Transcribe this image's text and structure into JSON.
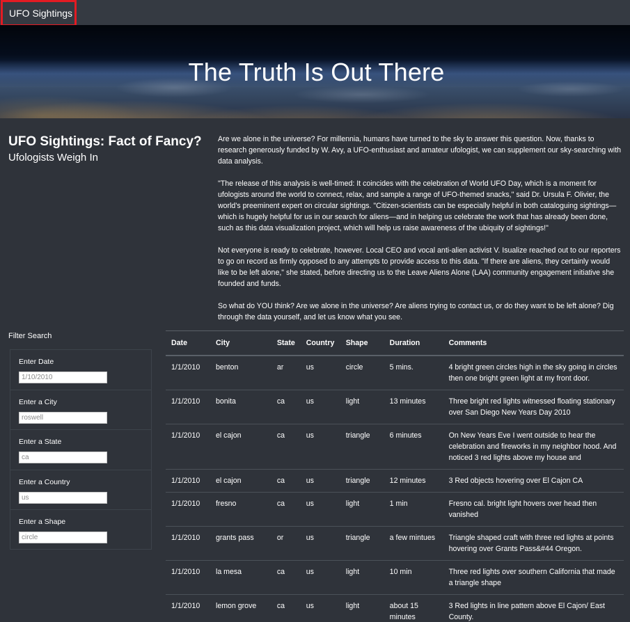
{
  "nav": {
    "brand": "UFO Sightings"
  },
  "hero": {
    "title": "The Truth Is Out There"
  },
  "intro": {
    "title": "UFO Sightings: Fact of Fancy?",
    "subtitle": "Ufologists Weigh In"
  },
  "article": {
    "paragraphs": [
      "Are we alone in the universe? For millennia, humans have turned to the sky to answer this question. Now, thanks to research generously funded by W. Avy, a UFO-enthusiast and amateur ufologist, we can supplement our sky-searching with data analysis.",
      "\"The release of this analysis is well-timed: It coincides with the celebration of World UFO Day, which is a moment for ufologists around the world to connect, relax, and sample a range of UFO-themed snacks,\" said Dr. Ursula F. Olivier, the world's preeminent expert on circular sightings. \"Citizen-scientists can be especially helpful in both cataloguing sightings—which is hugely helpful for us in our search for aliens—and in helping us celebrate the work that has already been done, such as this data visualization project, which will help us raise awareness of the ubiquity of sightings!\"",
      "Not everyone is ready to celebrate, however. Local CEO and vocal anti-alien activist V. Isualize reached out to our reporters to go on record as firmly opposed to any attempts to provide access to this data. \"If there are aliens, they certainly would like to be left alone,\" she stated, before directing us to the Leave Aliens Alone (LAA) community engagement initiative she founded and funds.",
      "So what do YOU think? Are we alone in the universe? Are aliens trying to contact us, or do they want to be left alone? Dig through the data yourself, and let us know what you see."
    ]
  },
  "filters": {
    "heading": "Filter Search",
    "fields": [
      {
        "label": "Enter Date",
        "placeholder": "1/10/2010"
      },
      {
        "label": "Enter a City",
        "placeholder": "roswell"
      },
      {
        "label": "Enter a State",
        "placeholder": "ca"
      },
      {
        "label": "Enter a Country",
        "placeholder": "us"
      },
      {
        "label": "Enter a Shape",
        "placeholder": "circle"
      }
    ]
  },
  "table": {
    "headers": [
      "Date",
      "City",
      "State",
      "Country",
      "Shape",
      "Duration",
      "Comments"
    ],
    "rows": [
      [
        "1/1/2010",
        "benton",
        "ar",
        "us",
        "circle",
        "5 mins.",
        "4 bright green circles high in the sky going in circles then one bright green light at my front door."
      ],
      [
        "1/1/2010",
        "bonita",
        "ca",
        "us",
        "light",
        "13 minutes",
        "Three bright red lights witnessed floating stationary over San Diego New Years Day 2010"
      ],
      [
        "1/1/2010",
        "el cajon",
        "ca",
        "us",
        "triangle",
        "6 minutes",
        "On New Years Eve I went outside to hear the celebration and fireworks in my neighbor hood. And noticed 3 red lights above my house and"
      ],
      [
        "1/1/2010",
        "el cajon",
        "ca",
        "us",
        "triangle",
        "12 minutes",
        "3 Red objects hovering over El Cajon CA"
      ],
      [
        "1/1/2010",
        "fresno",
        "ca",
        "us",
        "light",
        "1 min",
        "Fresno cal. bright light hovers over head then vanished"
      ],
      [
        "1/1/2010",
        "grants pass",
        "or",
        "us",
        "triangle",
        "a few mintues",
        "Triangle shaped craft with three red lights at points hovering over Grants Pass&#44 Oregon."
      ],
      [
        "1/1/2010",
        "la mesa",
        "ca",
        "us",
        "light",
        "10 min",
        "Three red lights over southern California that made a triangle shape"
      ],
      [
        "1/1/2010",
        "lemon grove",
        "ca",
        "us",
        "light",
        "about 15 minutes",
        "3 Red lights in line pattern above El Cajon/ East County."
      ]
    ]
  }
}
